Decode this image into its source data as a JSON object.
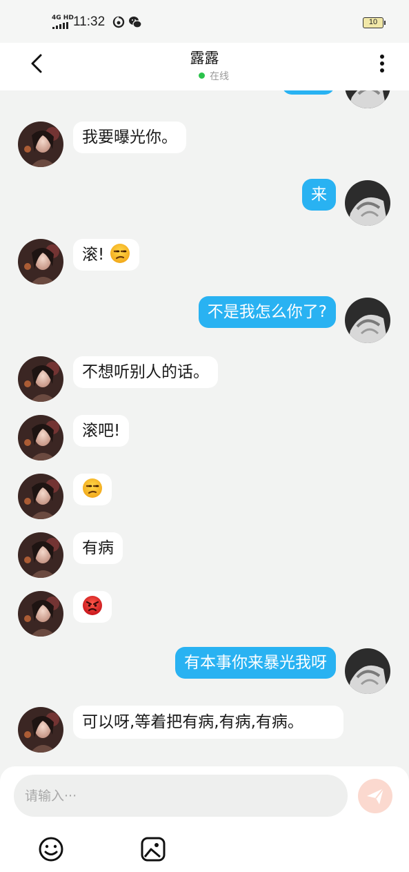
{
  "status_bar": {
    "time": "11:32",
    "network": "4G HD",
    "battery": "10"
  },
  "header": {
    "title": "露露",
    "status": "在线"
  },
  "colors": {
    "outgoing_bubble": "#29b2f2",
    "online_dot": "#2bc24b",
    "send_button": "#fbd9cf"
  },
  "messages": [
    {
      "side": "in",
      "text": "我要曝光你。"
    },
    {
      "side": "out",
      "text": "来"
    },
    {
      "side": "in",
      "text": "滚!",
      "emoji": "unamused-face"
    },
    {
      "side": "out",
      "text": "不是我怎么你了?"
    },
    {
      "side": "in",
      "text": "不想听别人的话。"
    },
    {
      "side": "in",
      "text": "滚吧!"
    },
    {
      "side": "in",
      "text": "",
      "emoji": "unamused-face"
    },
    {
      "side": "in",
      "text": "有病"
    },
    {
      "side": "in",
      "text": "",
      "emoji": "angry-face"
    },
    {
      "side": "out",
      "text": "有本事你来暴光我呀"
    },
    {
      "side": "in",
      "text": "可以呀,等着把有病,有病,有病。"
    }
  ],
  "composer": {
    "placeholder": "请输入···"
  }
}
